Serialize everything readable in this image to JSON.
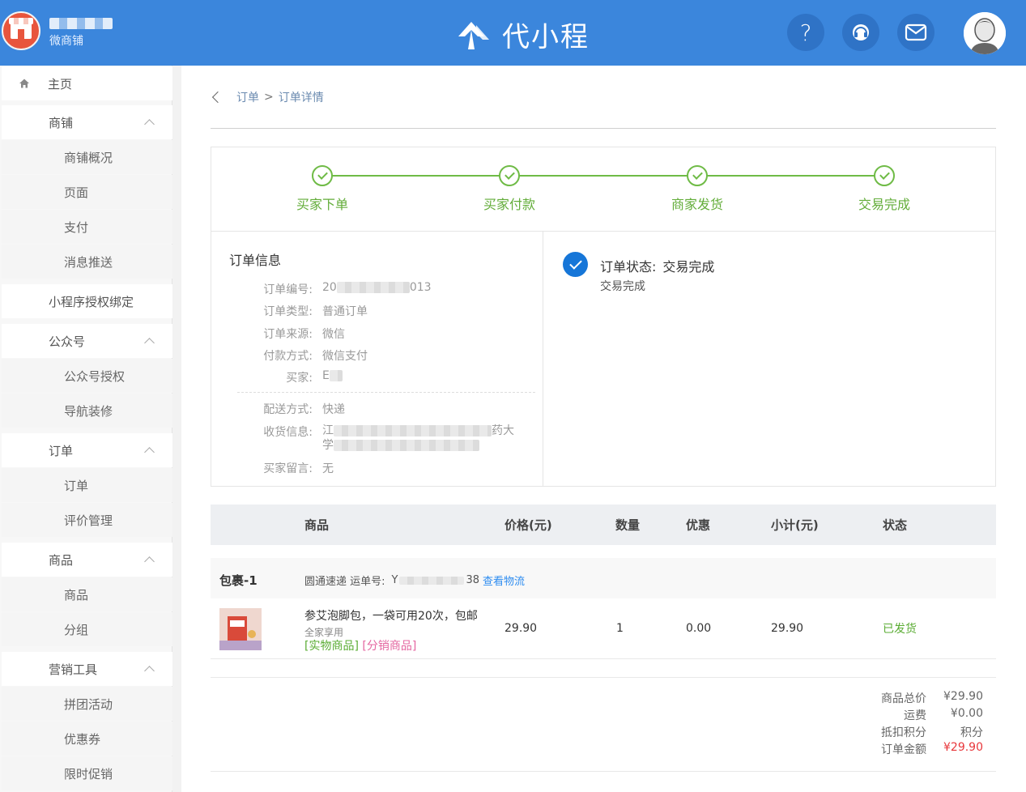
{
  "header": {
    "shop_subtitle": "微商铺",
    "brand_name": "代小程",
    "help_label": "?",
    "accent_color": "#3b86dc"
  },
  "sidebar": {
    "home": "主页",
    "items": [
      {
        "label": "商铺",
        "type": "group"
      },
      {
        "label": "商铺概况",
        "type": "sub"
      },
      {
        "label": "页面",
        "type": "sub"
      },
      {
        "label": "支付",
        "type": "sub"
      },
      {
        "label": "消息推送",
        "type": "sub"
      },
      {
        "label": "小程序授权绑定",
        "type": "top"
      },
      {
        "label": "公众号",
        "type": "group"
      },
      {
        "label": "公众号授权",
        "type": "sub"
      },
      {
        "label": "导航装修",
        "type": "sub"
      },
      {
        "label": "订单",
        "type": "group"
      },
      {
        "label": "订单",
        "type": "sub"
      },
      {
        "label": "评价管理",
        "type": "sub"
      },
      {
        "label": "商品",
        "type": "group"
      },
      {
        "label": "商品",
        "type": "sub"
      },
      {
        "label": "分组",
        "type": "sub"
      },
      {
        "label": "营销工具",
        "type": "group"
      },
      {
        "label": "拼团活动",
        "type": "sub"
      },
      {
        "label": "优惠券",
        "type": "sub"
      },
      {
        "label": "限时促销",
        "type": "sub"
      }
    ]
  },
  "breadcrumb": {
    "parent": "订单",
    "separator": ">",
    "current": "订单详情"
  },
  "steps": [
    "买家下单",
    "买家付款",
    "商家发货",
    "交易完成"
  ],
  "order_info": {
    "title": "订单信息",
    "number_label": "订单编号:",
    "number_prefix": "20",
    "number_suffix": "013",
    "type_label": "订单类型:",
    "type_value": "普通订单",
    "source_label": "订单来源:",
    "source_value": "微信",
    "pay_label": "付款方式:",
    "pay_value": "微信支付",
    "buyer_label": "买家:",
    "buyer_value": "E",
    "ship_label": "配送方式:",
    "ship_value": "快递",
    "addr_label": "收货信息:",
    "addr_start": "江",
    "addr_end": "药大",
    "addr_line2": "学",
    "msg_label": "买家留言:",
    "msg_value": "无"
  },
  "status": {
    "label": "订单状态:",
    "value": "交易完成",
    "sub": "交易完成"
  },
  "table": {
    "headers": {
      "product": "商品",
      "price": "价格(元)",
      "qty": "数量",
      "discount": "优惠",
      "subtotal": "小计(元)",
      "status": "状态"
    }
  },
  "package": {
    "name": "包裹-1",
    "carrier": "圆通速递 运单号:",
    "tracking_prefix": "Y",
    "tracking_suffix": "38",
    "link": "查看物流"
  },
  "product": {
    "title": "参艾泡脚包，一袋可用20次，包邮",
    "spec": "全家享用",
    "tag_real": "[实物商品]",
    "tag_dist": "[分销商品]",
    "price": "29.90",
    "qty": "1",
    "discount": "0.00",
    "subtotal": "29.90",
    "status": "已发货"
  },
  "totals": {
    "goods_label": "商品总价",
    "goods_value": "¥29.90",
    "freight_label": "运费",
    "freight_value": "¥0.00",
    "points_label": "抵扣积分",
    "points_value": "积分",
    "amount_label": "订单金额",
    "amount_value": "¥29.90"
  }
}
